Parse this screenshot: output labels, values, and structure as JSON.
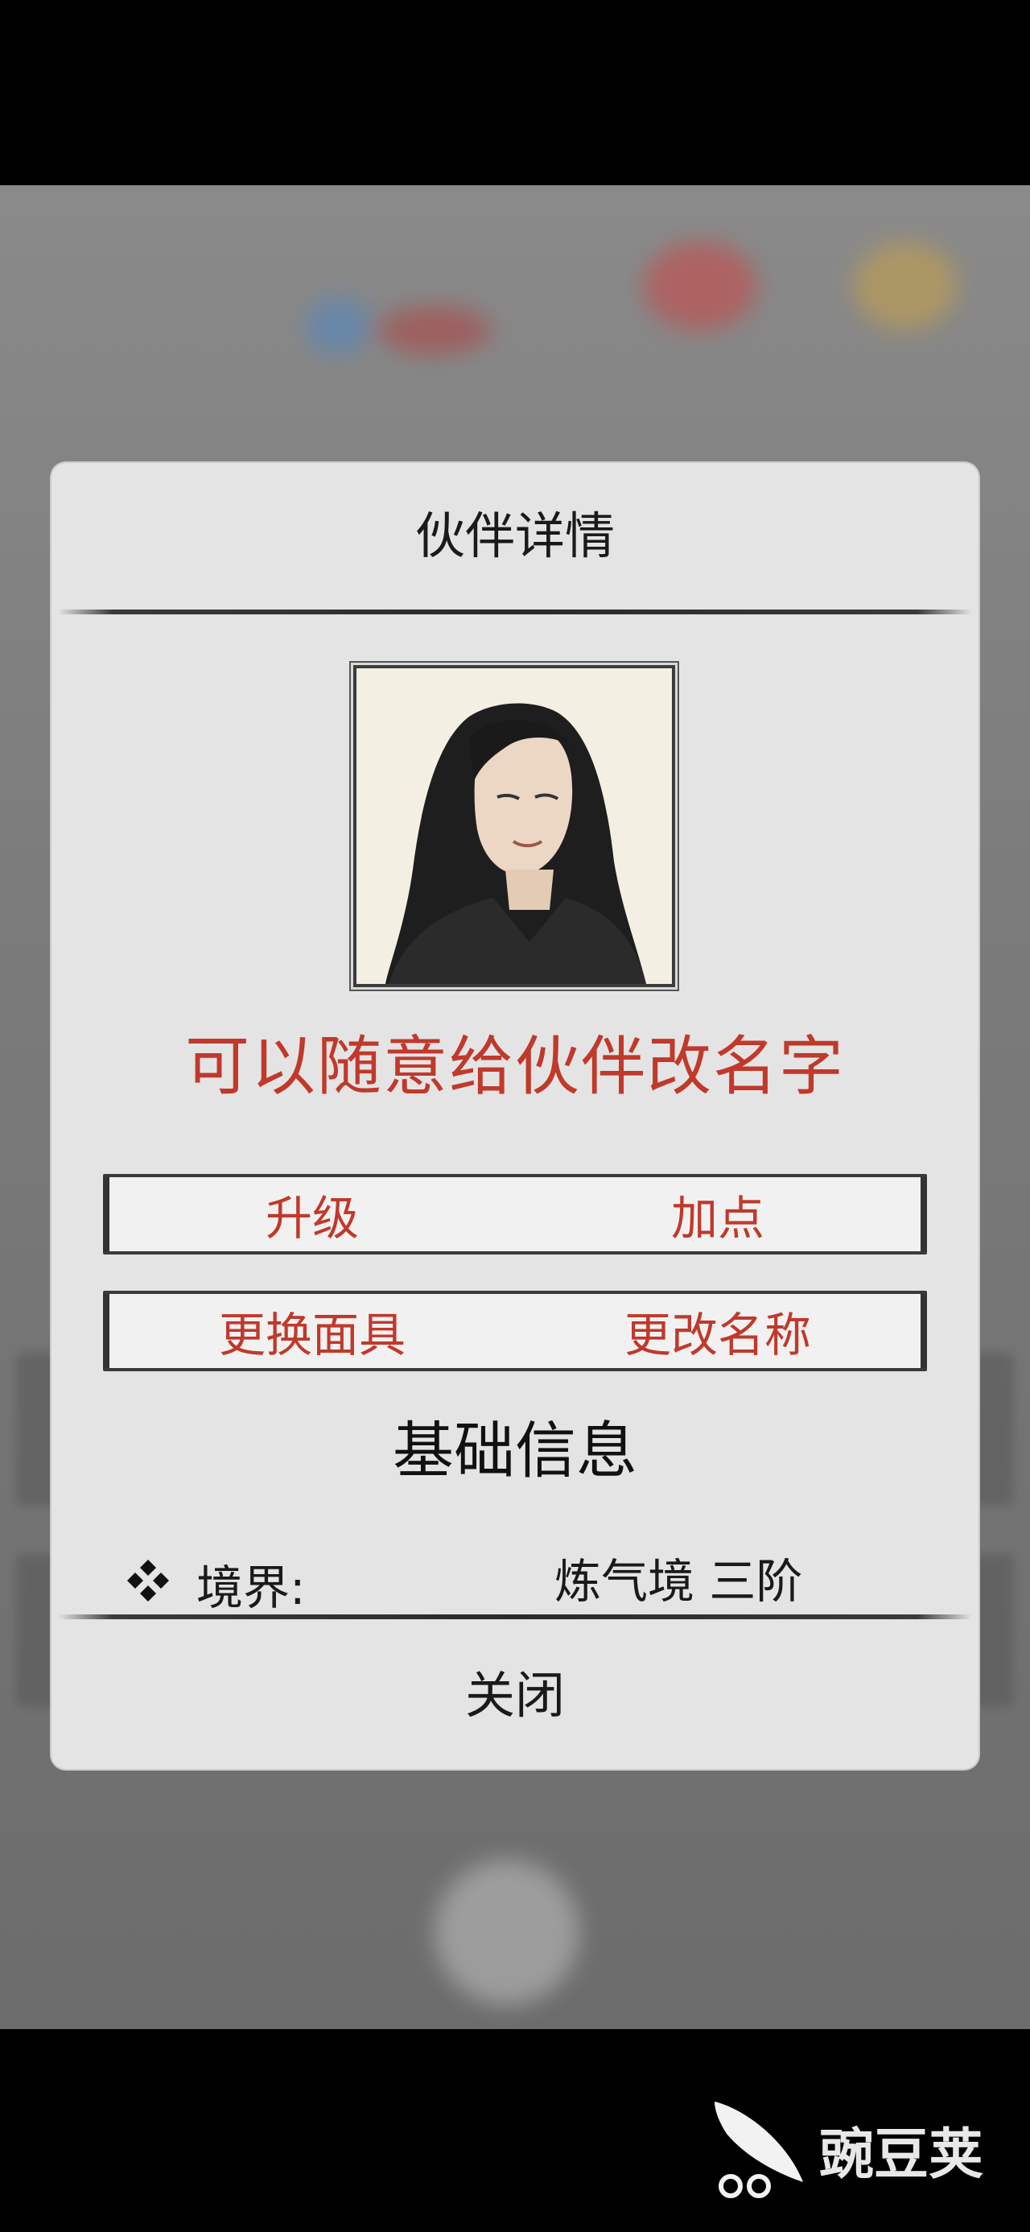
{
  "dialog": {
    "title": "伙伴详情",
    "caption": "可以随意给伙伴改名字",
    "buttons_row1": {
      "left": "升级",
      "right": "加点"
    },
    "buttons_row2": {
      "left": "更换面具",
      "right": "更改名称"
    },
    "section_title": "基础信息",
    "info": {
      "label": "境界:",
      "value": "炼气境  三阶"
    },
    "close_label": "关闭"
  },
  "watermark": {
    "text": "豌豆荚"
  },
  "colors": {
    "accent": "#c0392b",
    "dialog_bg": "#e4e4e4",
    "text": "#1a1a1a"
  },
  "icons": {
    "info_bullet": "diamond-cluster-icon",
    "watermark_logo": "pea-pod-logo"
  }
}
